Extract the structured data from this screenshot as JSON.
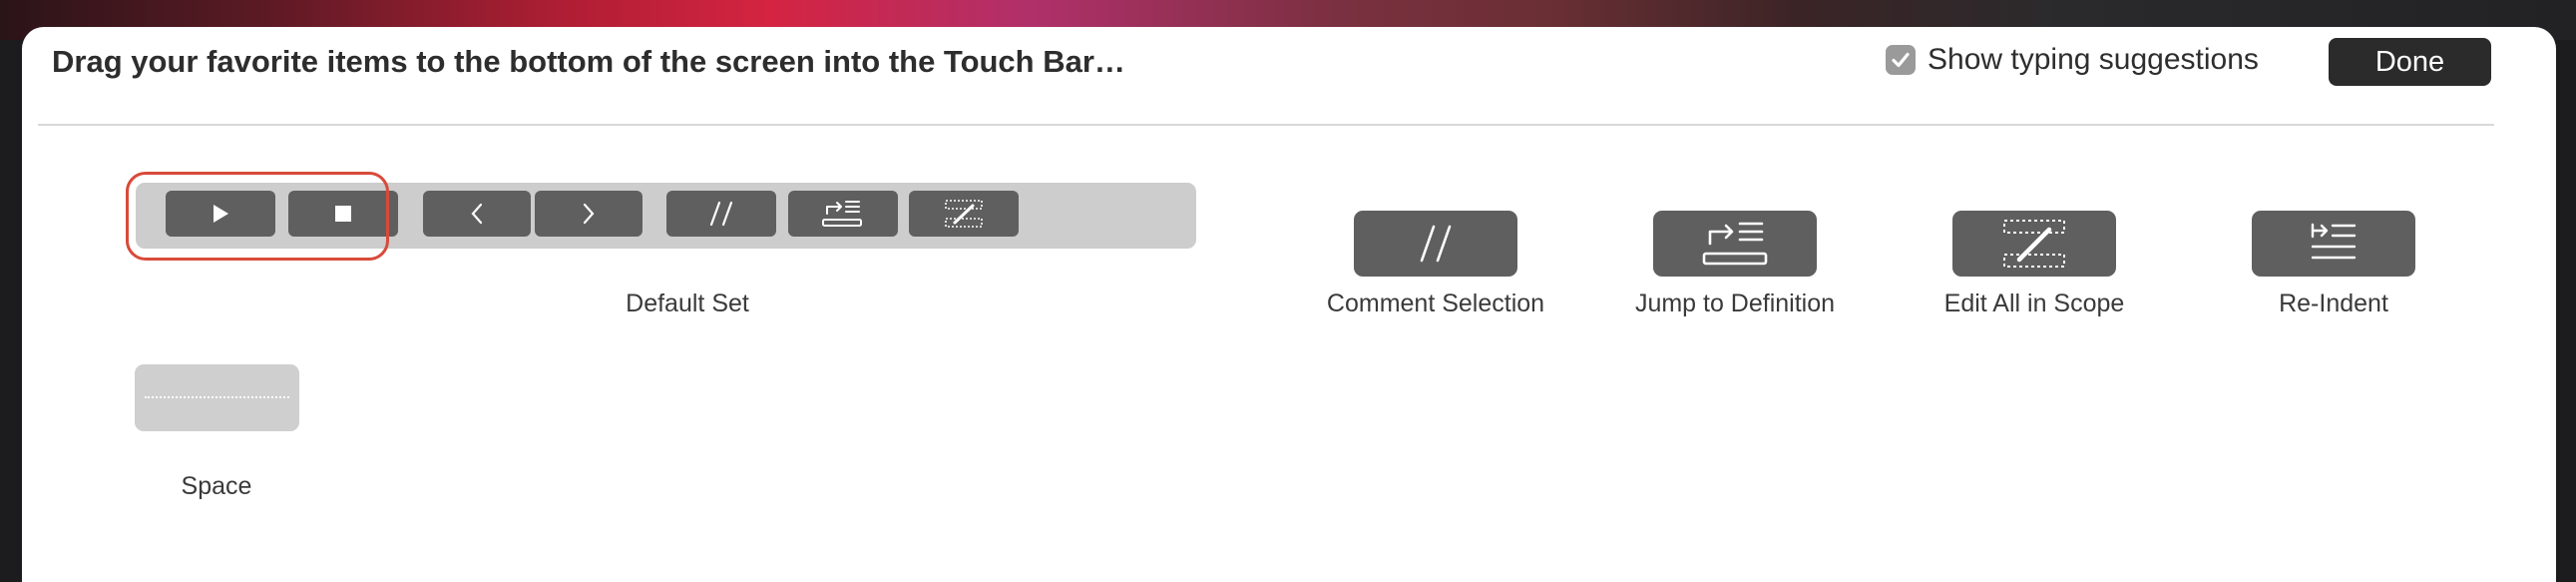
{
  "header": {
    "instructions": "Drag your favorite items to the bottom of the screen into the Touch Bar…",
    "suggestions_label": "Show typing suggestions",
    "suggestions_checked": true,
    "done_label": "Done"
  },
  "default_set": {
    "label": "Default Set",
    "keys": [
      "play-icon",
      "stop-icon",
      "chevron-left-icon",
      "chevron-right-icon",
      "comment-icon",
      "jump-to-definition-icon",
      "edit-all-in-scope-icon"
    ]
  },
  "items": [
    {
      "label": "Comment Selection",
      "icon": "comment-icon"
    },
    {
      "label": "Jump to Definition",
      "icon": "jump-to-definition-icon"
    },
    {
      "label": "Edit All in Scope",
      "icon": "edit-all-in-scope-icon"
    },
    {
      "label": "Re-Indent",
      "icon": "re-indent-icon"
    },
    {
      "label": "Space",
      "icon": "space-icon"
    }
  ],
  "colors": {
    "highlight": "#d84a3a",
    "key_fill": "#5f5f5f",
    "done_button": "#2b2b2b"
  }
}
